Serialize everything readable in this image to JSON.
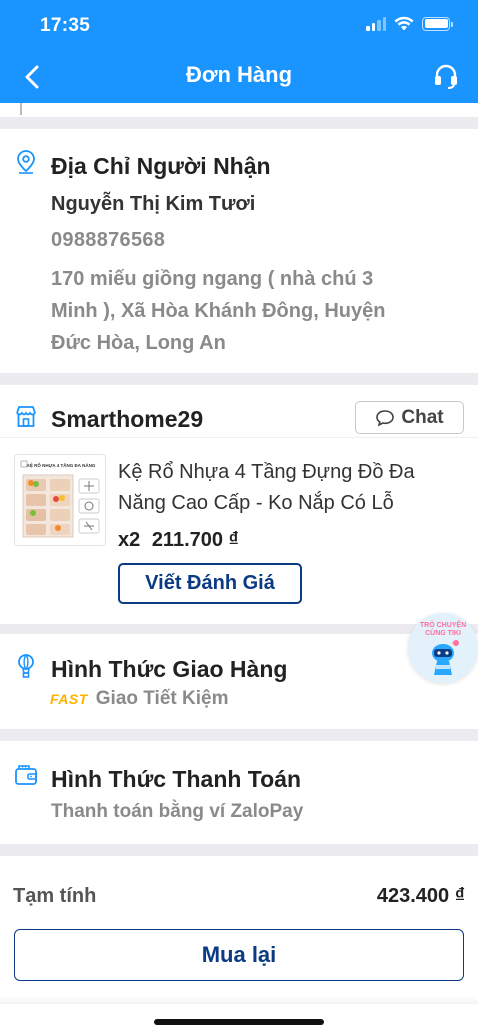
{
  "status_bar": {
    "time": "17:35"
  },
  "nav": {
    "title": "Đơn Hàng",
    "back_icon": "chevron-left-icon",
    "support_icon": "headset-icon"
  },
  "colors": {
    "primary": "#1a94ff",
    "button_blue": "#0b3b82",
    "fast": "#ffb300",
    "muted": "#8a8a8a"
  },
  "address": {
    "title": "Địa Chỉ Người Nhận",
    "icon": "location-pin-icon",
    "name": "Nguyễn Thị Kim Tươi",
    "phone": "0988876568",
    "lines": [
      "170 miếu giồng ngang ( nhà chú 3",
      "Minh ), Xã Hòa Khánh Đông, Huyện",
      "Đức Hòa, Long An"
    ]
  },
  "shop": {
    "icon": "store-icon",
    "name": "Smarthome29",
    "chat_label": "Chat",
    "product": {
      "name_lines": [
        "Kệ Rổ Nhựa 4 Tầng Đựng Đồ Đa",
        "Năng Cao Cấp - Ko Nắp Có Lỗ"
      ],
      "quantity": "x2",
      "price": "211.700 ₫",
      "thumb_caption": "KỆ RỔ NHỰA 4 TẦNG ĐA NĂNG"
    },
    "review_label": "Viết Đánh Giá"
  },
  "delivery": {
    "icon": "balloon-icon",
    "title": "Hình Thức Giao Hàng",
    "badge": "FAST",
    "method": "Giao Tiết Kiệm"
  },
  "payment": {
    "icon": "wallet-icon",
    "title": "Hình Thức Thanh Toán",
    "method": "Thanh toán bằng ví ZaloPay"
  },
  "summary": {
    "subtotal_label": "Tạm tính",
    "subtotal_value": "423.400 ₫",
    "buy_again_label": "Mua lại"
  },
  "mascot": {
    "text_line1": "TRÒ CHUYỆN",
    "text_line2": "CÙNG TIKI"
  }
}
